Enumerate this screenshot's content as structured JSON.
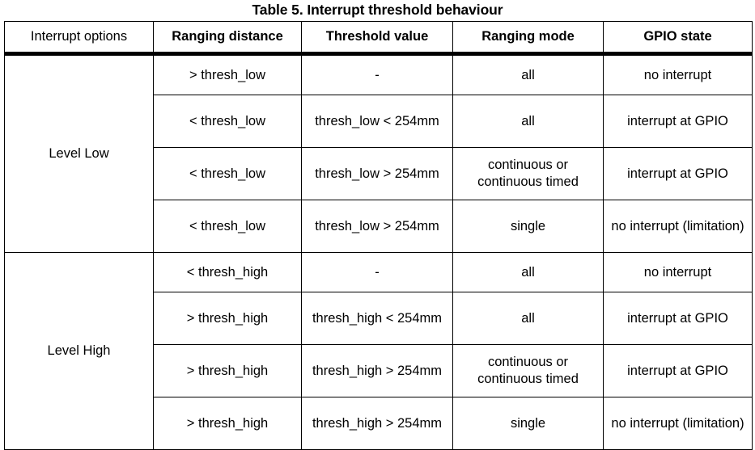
{
  "caption": "Table 5. Interrupt threshold behaviour",
  "table": {
    "columns": [
      {
        "label": "Interrupt options",
        "bold": false
      },
      {
        "label": "Ranging distance",
        "bold": true
      },
      {
        "label": "Threshold value",
        "bold": true
      },
      {
        "label": "Ranging mode",
        "bold": true
      },
      {
        "label": "GPIO state",
        "bold": true
      }
    ],
    "groups": [
      {
        "label": "Level Low",
        "rows": [
          {
            "ranging_distance": "> thresh_low",
            "threshold_value": "-",
            "ranging_mode": "all",
            "gpio_state": "no interrupt"
          },
          {
            "ranging_distance": "< thresh_low",
            "threshold_value": "thresh_low < 254mm",
            "ranging_mode": "all",
            "gpio_state": "interrupt at GPIO"
          },
          {
            "ranging_distance": "< thresh_low",
            "threshold_value": "thresh_low > 254mm",
            "ranging_mode": "continuous or continuous timed",
            "gpio_state": "interrupt at GPIO"
          },
          {
            "ranging_distance": "< thresh_low",
            "threshold_value": "thresh_low > 254mm",
            "ranging_mode": "single",
            "gpio_state": "no interrupt (limitation)"
          }
        ]
      },
      {
        "label": "Level High",
        "rows": [
          {
            "ranging_distance": "< thresh_high",
            "threshold_value": "-",
            "ranging_mode": "all",
            "gpio_state": "no interrupt"
          },
          {
            "ranging_distance": "> thresh_high",
            "threshold_value": "thresh_high < 254mm",
            "ranging_mode": "all",
            "gpio_state": "interrupt at GPIO"
          },
          {
            "ranging_distance": "> thresh_high",
            "threshold_value": "thresh_high > 254mm",
            "ranging_mode": "continuous or continuous timed",
            "gpio_state": "interrupt at GPIO"
          },
          {
            "ranging_distance": "> thresh_high",
            "threshold_value": "thresh_high > 254mm",
            "ranging_mode": "single",
            "gpio_state": "no interrupt (limitation)"
          }
        ]
      }
    ]
  },
  "colors": {
    "text": "#000000",
    "background": "#ffffff",
    "border": "#000000"
  }
}
